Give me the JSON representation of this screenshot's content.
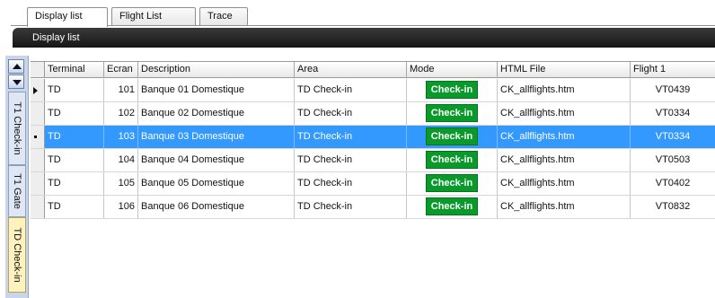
{
  "tabs": [
    {
      "label": "Display list",
      "active": true
    },
    {
      "label": "Flight List",
      "active": false
    },
    {
      "label": "Trace",
      "active": false
    }
  ],
  "panel": {
    "title": "Display list"
  },
  "side_tabs": [
    {
      "label": "T1 Check-in",
      "selected": false
    },
    {
      "label": "T1 Gate",
      "selected": false
    },
    {
      "label": "TD Check-in",
      "selected": true
    }
  ],
  "grid": {
    "columns": [
      "Terminal",
      "Ecran",
      "Description",
      "Area",
      "Mode",
      "HTML File",
      "Flight 1"
    ],
    "rows": [
      {
        "terminal": "TD",
        "ecran": "101",
        "description": "Banque 01 Domestique",
        "area": "TD Check-in",
        "mode": "Check-in",
        "html_file": "CK_allflights.htm",
        "flight1": "VT0439",
        "indicator": "arrow",
        "selected": false
      },
      {
        "terminal": "TD",
        "ecran": "102",
        "description": "Banque 02 Domestique",
        "area": "TD Check-in",
        "mode": "Check-in",
        "html_file": "CK_allflights.htm",
        "flight1": "VT0334",
        "indicator": "",
        "selected": false
      },
      {
        "terminal": "TD",
        "ecran": "103",
        "description": "Banque 03 Domestique",
        "area": "TD Check-in",
        "mode": "Check-in",
        "html_file": "CK_allflights.htm",
        "flight1": "VT0334",
        "indicator": "dot",
        "selected": true
      },
      {
        "terminal": "TD",
        "ecran": "104",
        "description": "Banque 04 Domestique",
        "area": "TD Check-in",
        "mode": "Check-in",
        "html_file": "CK_allflights.htm",
        "flight1": "VT0503",
        "indicator": "",
        "selected": false
      },
      {
        "terminal": "TD",
        "ecran": "105",
        "description": "Banque 05 Domestique",
        "area": "TD Check-in",
        "mode": "Check-in",
        "html_file": "CK_allflights.htm",
        "flight1": "VT0402",
        "indicator": "",
        "selected": false
      },
      {
        "terminal": "TD",
        "ecran": "106",
        "description": "Banque 06 Domestique",
        "area": "TD Check-in",
        "mode": "Check-in",
        "html_file": "CK_allflights.htm",
        "flight1": "VT0832",
        "indicator": "",
        "selected": false
      }
    ]
  },
  "colors": {
    "selection": "#3399ff",
    "mode_badge": "#0a9a2c",
    "titlebar": "#1e1e1e"
  }
}
